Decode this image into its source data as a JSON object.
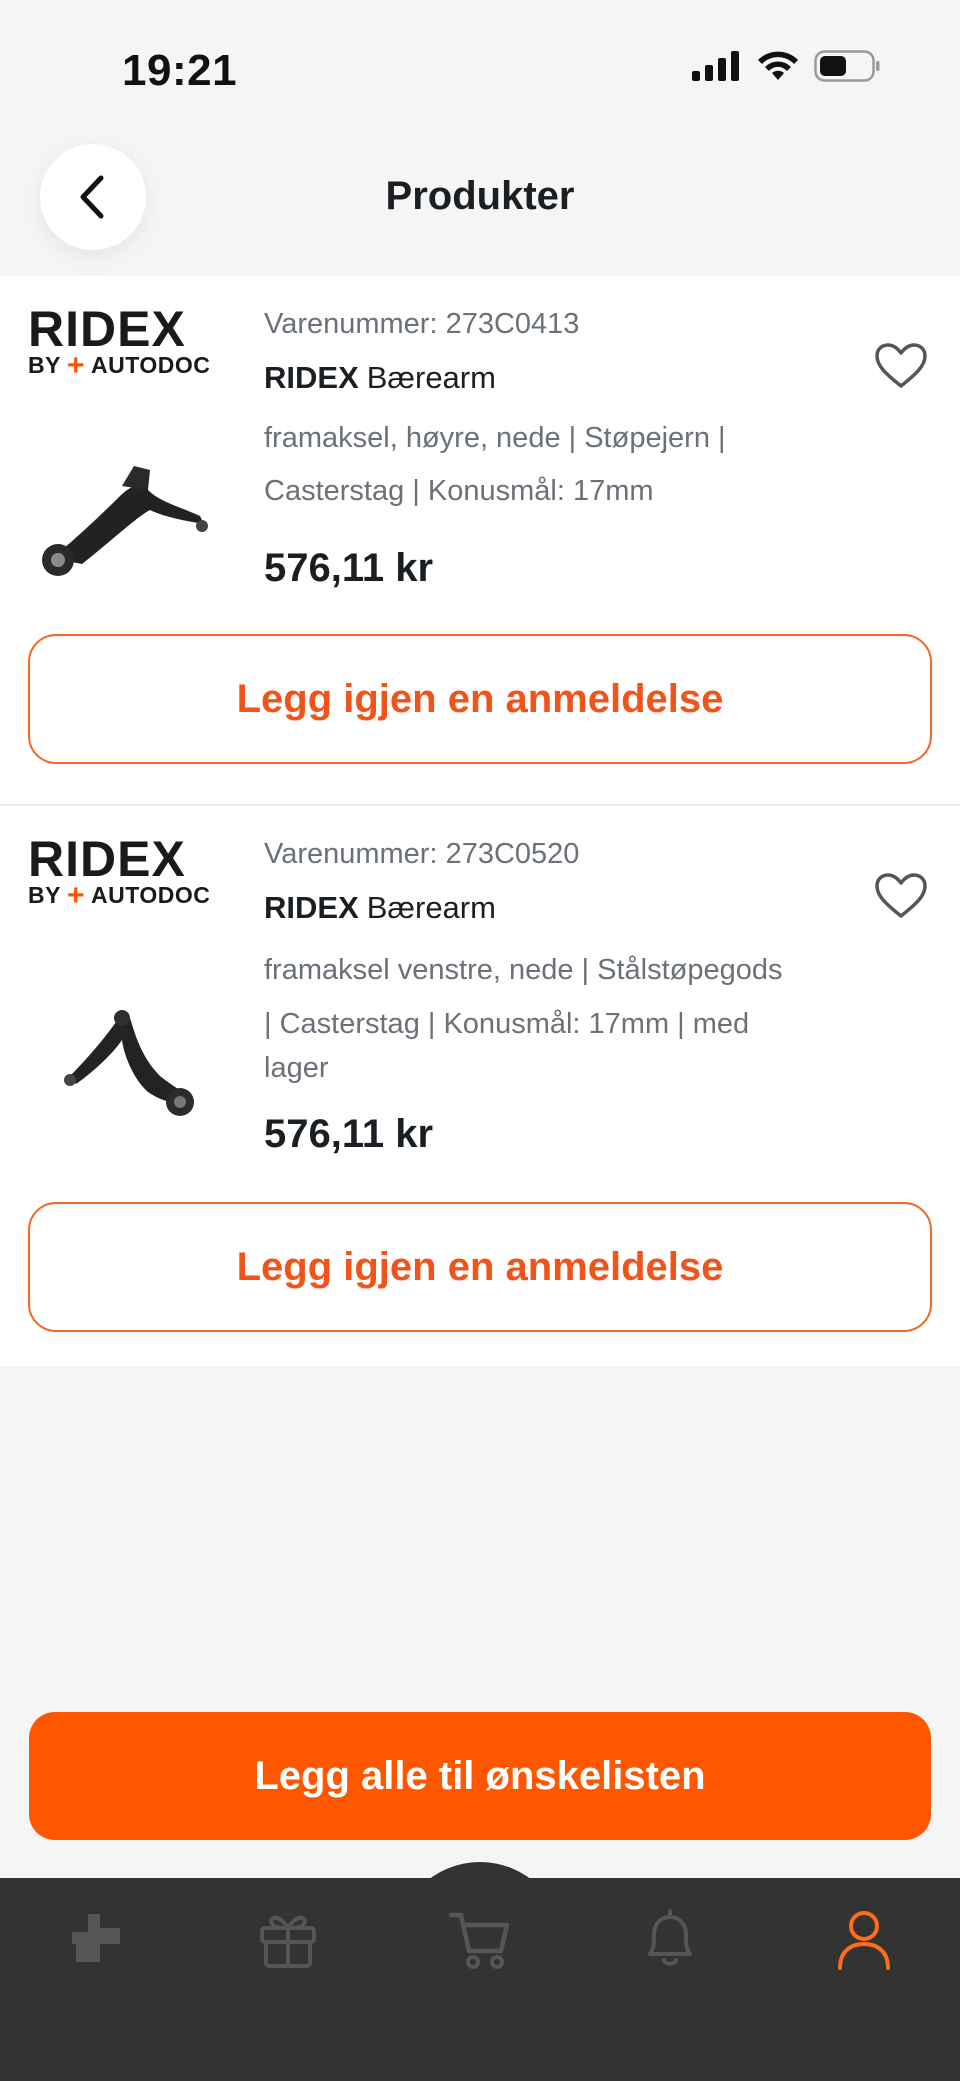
{
  "status_bar": {
    "time": "19:21",
    "icons": [
      "signal-icon",
      "wifi-icon",
      "battery-icon"
    ]
  },
  "header": {
    "title": "Produkter",
    "back_icon": "chevron-left-icon"
  },
  "products": [
    {
      "logo_text": "RIDEX",
      "logo_sub": "AUTODOC",
      "logo_by": "BY",
      "sku": "Varenummer: 273C0413",
      "brand": "RIDEX",
      "name": "Bærearm",
      "desc_lines": [
        "framaksel, høyre, nede | Støpejern |",
        "Casterstag | Konusmål: 17mm"
      ],
      "price": "576,11 kr",
      "review_label": "Legg igjen en anmeldelse"
    },
    {
      "logo_text": "RIDEX",
      "logo_sub": "AUTODOC",
      "logo_by": "BY",
      "sku": "Varenummer: 273C0520",
      "brand": "RIDEX",
      "name": "Bærearm",
      "desc_lines": [
        "framaksel venstre, nede | Stålstøpegods",
        "| Casterstag | Konusmål: 17mm | med",
        "lager"
      ],
      "price": "576,11 kr",
      "review_label": "Legg igjen en anmeldelse"
    }
  ],
  "wishlist_button": {
    "label": "Legg alle til ønskelisten"
  },
  "colors": {
    "accent": "#ff5700",
    "nav_bg": "#333333",
    "nav_icon": "#555555",
    "nav_active": "#ff6b1a"
  },
  "bottom_nav": [
    {
      "icon": "parts-icon",
      "active": false
    },
    {
      "icon": "gift-icon",
      "active": false
    },
    {
      "icon": "cart-icon",
      "active": false
    },
    {
      "icon": "bell-icon",
      "active": false
    },
    {
      "icon": "user-icon",
      "active": true
    }
  ]
}
